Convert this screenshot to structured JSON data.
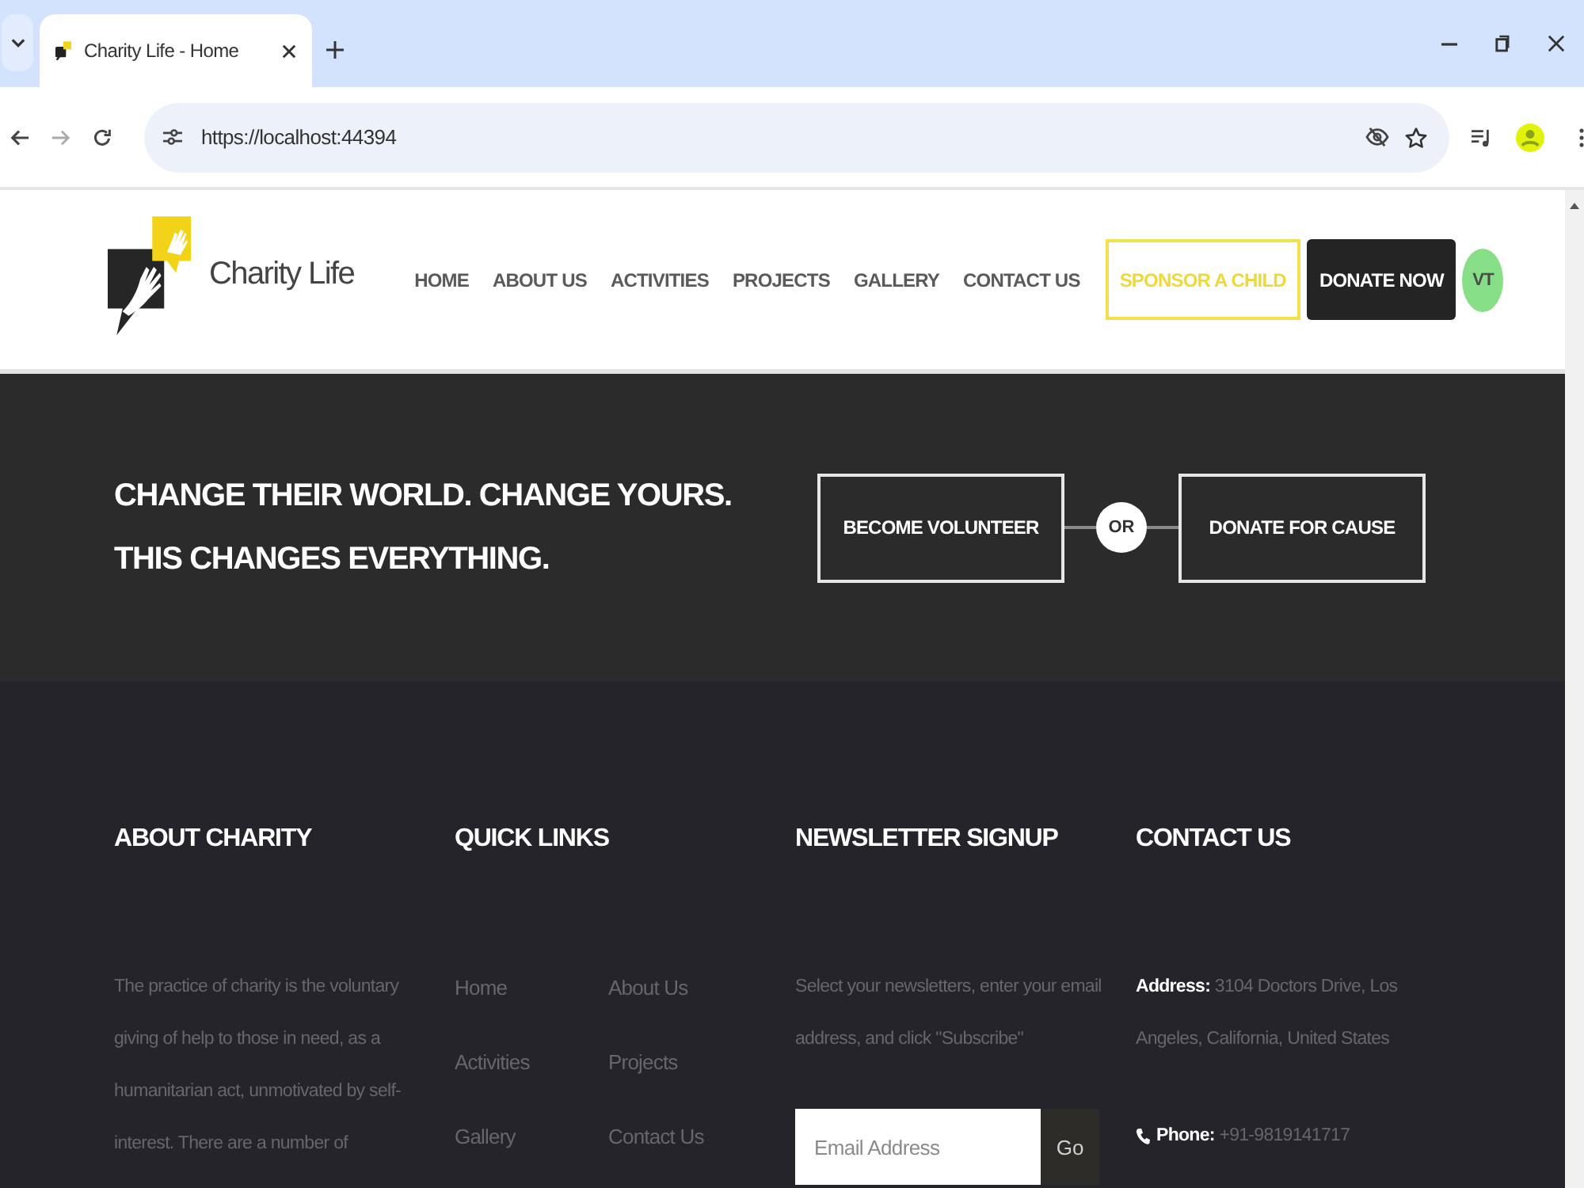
{
  "browser": {
    "tabs": [
      {
        "title": "Charity Life - Home",
        "selected": true
      }
    ],
    "url": "https://localhost:44394"
  },
  "header": {
    "logo_text": "Charity Life",
    "nav": [
      "HOME",
      "ABOUT US",
      "ACTIVITIES",
      "PROJECTS",
      "GALLERY",
      "CONTACT US"
    ],
    "sponsor_button": "SPONSOR A CHILD",
    "donate_button": "DONATE NOW",
    "avatar_initials": "VT"
  },
  "cta": {
    "headline": [
      "CHANGE THEIR WORLD. CHANGE YOURS.",
      "THIS CHANGES EVERYTHING."
    ],
    "volunteer_button": "BECOME VOLUNTEER",
    "separator": "OR",
    "donate_button": "DONATE FOR CAUSE"
  },
  "footer": {
    "about": {
      "heading": "ABOUT CHARITY",
      "text": "The practice of charity is the voluntary giving of help to those in need, as a humanitarian act, unmotivated by self-interest. There are a number of"
    },
    "quick_links": {
      "heading": "QUICK LINKS",
      "links": [
        "Home",
        "About Us",
        "Activities",
        "Projects",
        "Gallery",
        "Contact Us"
      ]
    },
    "newsletter": {
      "heading": "NEWSLETTER SIGNUP",
      "text": "Select your newsletters, enter your email address, and click \"Subscribe\"",
      "placeholder": "Email Address",
      "button": "Go"
    },
    "contact": {
      "heading": "CONTACT US",
      "items": [
        {
          "kind": "address",
          "text": "**Address:** 3104 Doctors Drive, Los Angeles, California, United States"
        },
        {
          "kind": "phone",
          "text": "**Phone:** +91-9819141717"
        }
      ]
    }
  }
}
